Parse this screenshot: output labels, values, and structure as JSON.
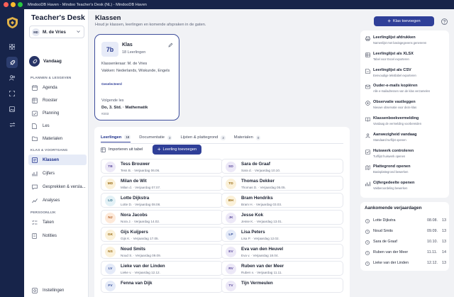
{
  "window": {
    "title": "MindooDB Haven - Mindoo Teacher's Desk (NL) - MindooDB Haven",
    "controls": {
      "close": "#ff5f57",
      "minimize": "#febc2e",
      "maximize": "#28c840"
    }
  },
  "app": {
    "brand": "Teacher's Desk",
    "accent": "#2f3f98",
    "dark": "#17244a"
  },
  "user": {
    "initials": "MD",
    "name": "M. de Vries"
  },
  "rail": {
    "items": [
      "grid-icon",
      "rocket-icon",
      "people-icon",
      "scan-icon",
      "image-icon",
      "transfer-icon"
    ],
    "active": 1
  },
  "sidebar": {
    "today": "Vandaag",
    "sections": [
      {
        "title": "PLANNEN & LESGEVEN",
        "items": [
          {
            "label": "Agenda",
            "icon": "calendar-icon"
          },
          {
            "label": "Rooster",
            "icon": "table-icon"
          },
          {
            "label": "Planning",
            "icon": "planning-icon"
          },
          {
            "label": "Les",
            "icon": "file-icon"
          },
          {
            "label": "Materialen",
            "icon": "folder-icon"
          }
        ]
      },
      {
        "title": "KLAS & VOORTGANG",
        "items": [
          {
            "label": "Klassen",
            "icon": "class-icon",
            "active": true
          },
          {
            "label": "Cijfers",
            "icon": "chart-icon"
          },
          {
            "label": "Gesprekken & versla...",
            "icon": "chat-icon"
          },
          {
            "label": "Analyses",
            "icon": "analytics-icon"
          }
        ]
      },
      {
        "title": "PERSOONLIJK",
        "items": [
          {
            "label": "Taken",
            "icon": "checklist-icon"
          },
          {
            "label": "Notities",
            "icon": "note-icon"
          }
        ]
      }
    ],
    "settings": "Instellingen"
  },
  "page": {
    "title": "Klassen",
    "subtitle": "Houd je klassen, leerlingen en komende afspraken in de gaten.",
    "add_class": "Klas toevoegen"
  },
  "class_card": {
    "code": "7b",
    "title": "Klas",
    "students": "18 Leerlingen",
    "teacher": "Klassenleraar: M. de Vries",
    "subjects": "Vakken: Nederlands, Wiskunde, Engels",
    "status": "Geselecteerd",
    "next_label": "Volgende les",
    "next_value": "Do, 3. Std. · Mathematik",
    "room": "#203"
  },
  "tabs": [
    {
      "label": "Leerlingen",
      "count": "18",
      "active": true
    },
    {
      "label": "Documentatie",
      "count": "3"
    },
    {
      "label": "Lijsten & plattegrond",
      "count": "3"
    },
    {
      "label": "Materialen",
      "count": "0"
    }
  ],
  "toolbar": {
    "import": "Importeren uit tabel",
    "add_student": "Leerling toevoegen"
  },
  "students": [
    {
      "initials": "TB",
      "name": "Tess Brouwer",
      "meta": "Tess B. · Verjaardag 06.06.",
      "bg": "#ece8f7",
      "fg": "#5c4a9c"
    },
    {
      "initials": "SD",
      "name": "Sara de Graaf",
      "meta": "Sara d. · Verjaardag 10.10.",
      "bg": "#ece8f7",
      "fg": "#5c4a9c"
    },
    {
      "initials": "MD",
      "name": "Milan de Wit",
      "meta": "Milan d. · Verjaardag 07.07.",
      "bg": "#fbf1d9",
      "fg": "#9a6b12"
    },
    {
      "initials": "TD",
      "name": "Thomas Dekker",
      "meta": "Thomas D. · Verjaardag 05.05.",
      "bg": "#fbf1d9",
      "fg": "#9a6b12"
    },
    {
      "initials": "LD",
      "name": "Lotte Dijkstra",
      "meta": "Lotte D. · Verjaardag 08.08.",
      "bg": "#e3f1f6",
      "fg": "#2d6e89"
    },
    {
      "initials": "BH",
      "name": "Bram Hendriks",
      "meta": "Bram H. · Verjaardag 03.03.",
      "bg": "#fbf1d9",
      "fg": "#9a6b12"
    },
    {
      "initials": "NJ",
      "name": "Nora Jacobs",
      "meta": "Nora J. · Verjaardag 14.02.",
      "bg": "#fde9d9",
      "fg": "#b05b1e"
    },
    {
      "initials": "JK",
      "name": "Jesse Kok",
      "meta": "Jesse K. · Verjaardag 13.01.",
      "bg": "#ece8f7",
      "fg": "#5c4a9c"
    },
    {
      "initials": "GK",
      "name": "Gijs Kuijpers",
      "meta": "Gijs K. · Verjaardag 17.05.",
      "bg": "#fbf1d9",
      "fg": "#9a6b12"
    },
    {
      "initials": "LP",
      "name": "Lisa Peters",
      "meta": "Lisa P. · Verjaardag 12.02.",
      "bg": "#e4eaf8",
      "fg": "#36509a"
    },
    {
      "initials": "NS",
      "name": "Noud Smits",
      "meta": "Noud S. · Verjaardag 09.09.",
      "bg": "#fbf1d9",
      "fg": "#9a6b12"
    },
    {
      "initials": "EV",
      "name": "Eva van den Heuvel",
      "meta": "Eva v. · Verjaardag 18.04.",
      "bg": "#ece8f7",
      "fg": "#5c4a9c"
    },
    {
      "initials": "LV",
      "name": "Lieke van der Linden",
      "meta": "Lieke v. · Verjaardag 12.12.",
      "bg": "#e4eaf8",
      "fg": "#36509a"
    },
    {
      "initials": "RV",
      "name": "Ruben van der Meer",
      "meta": "Ruben v. · Verjaardag 11.11.",
      "bg": "#ece8f7",
      "fg": "#5c4a9c"
    },
    {
      "initials": "FV",
      "name": "Fenna van Dijk",
      "meta": "",
      "bg": "#e4eaf8",
      "fg": "#36509a"
    },
    {
      "initials": "TV",
      "name": "Tijn Vermeulen",
      "meta": "",
      "bg": "#ece8f7",
      "fg": "#5c4a9c"
    }
  ],
  "actions": [
    {
      "title": "Leerlinglijst afdrukken",
      "sub": "Namenlijst met basisgegevens genereren",
      "icon": "print-icon"
    },
    {
      "title": "Leerlinglijst als XLSX",
      "sub": "Tabel voor Excel exporteren",
      "icon": "spreadsheet-icon"
    },
    {
      "title": "Leerlinglijst als CSV",
      "sub": "Eenvoudige tekstlabel exporteren",
      "icon": "csv-icon"
    },
    {
      "title": "Ouder-e-mails kopiëren",
      "sub": "Alle e-mailadressen van de klas verzamelen",
      "icon": "mail-icon"
    },
    {
      "title": "Observatie vastleggen",
      "sub": "Nieuwe observatie voor deze klas",
      "icon": "observation-icon"
    },
    {
      "title": "Klassenboekvermelding",
      "sub": "Vandaag de vermelding voorbereiden",
      "icon": "book-icon"
    },
    {
      "title": "Aanwezigheid vandaag",
      "sub": "Standaard turflijst openen",
      "icon": "attendance-icon"
    },
    {
      "title": "Huiswerk controleren",
      "sub": "Turflijst huiswerk openen",
      "icon": "homework-icon"
    },
    {
      "title": "Plattegrond openen",
      "sub": "Basisplattegrond bewerken",
      "icon": "map-icon"
    },
    {
      "title": "Cijfergedeelte openen",
      "sub": "Vakberoordeling bewerken",
      "icon": "grades-icon"
    }
  ],
  "birthdays": {
    "title": "Aankomende verjaardagen",
    "items": [
      {
        "name": "Lotte Dijkstra",
        "date": "08.08.",
        "count": "13"
      },
      {
        "name": "Noud Smits",
        "date": "09.09.",
        "count": "13"
      },
      {
        "name": "Sara de Graaf",
        "date": "10.10.",
        "count": "13"
      },
      {
        "name": "Ruben van der Meer",
        "date": "11.11.",
        "count": "14"
      },
      {
        "name": "Lieke van der Linden",
        "date": "12.12.",
        "count": "13"
      }
    ]
  }
}
